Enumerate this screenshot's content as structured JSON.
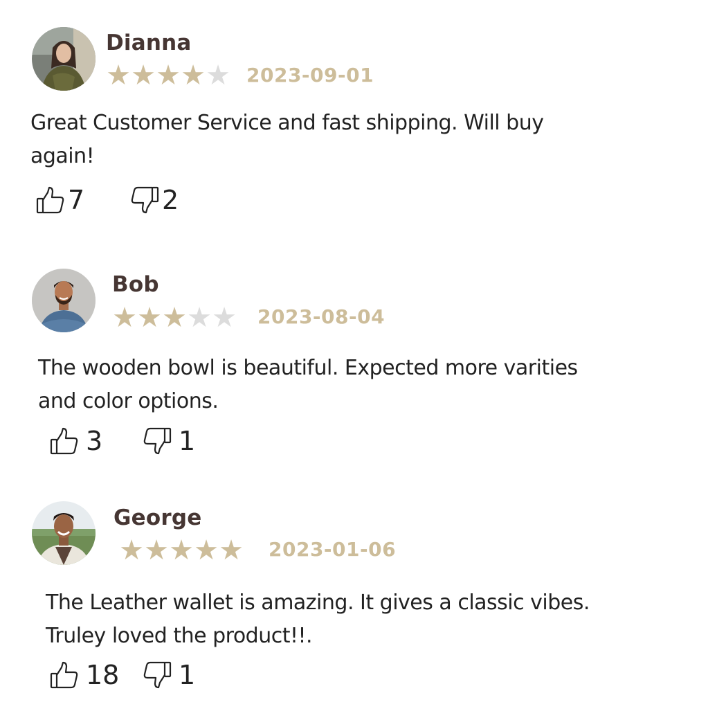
{
  "colors": {
    "name": "#463633",
    "star_filled": "#cdbd9a",
    "star_empty": "#dcdcdc",
    "date": "#cdbd9a",
    "text": "#222222"
  },
  "reviews": [
    {
      "name": "Dianna",
      "rating": 4,
      "max_rating": 5,
      "date": "2023-09-01",
      "line1": "Great Customer Service and fast shipping. Will buy",
      "line2": "again!",
      "likes": "7",
      "dislikes": "2"
    },
    {
      "name": "Bob",
      "rating": 3,
      "max_rating": 5,
      "date": "2023-08-04",
      "line1": "The wooden bowl is beautiful. Expected more varities",
      "line2": "and color options.",
      "likes": "3",
      "dislikes": "1"
    },
    {
      "name": "George",
      "rating": 5,
      "max_rating": 5,
      "date": "2023-01-06",
      "line1": "The Leather wallet is amazing. It gives a classic vibes.",
      "line2": "Truley loved the product!!.",
      "likes": "18",
      "dislikes": "1"
    }
  ],
  "icons": {
    "like": "thumbs-up-icon",
    "dislike": "thumbs-down-icon"
  }
}
